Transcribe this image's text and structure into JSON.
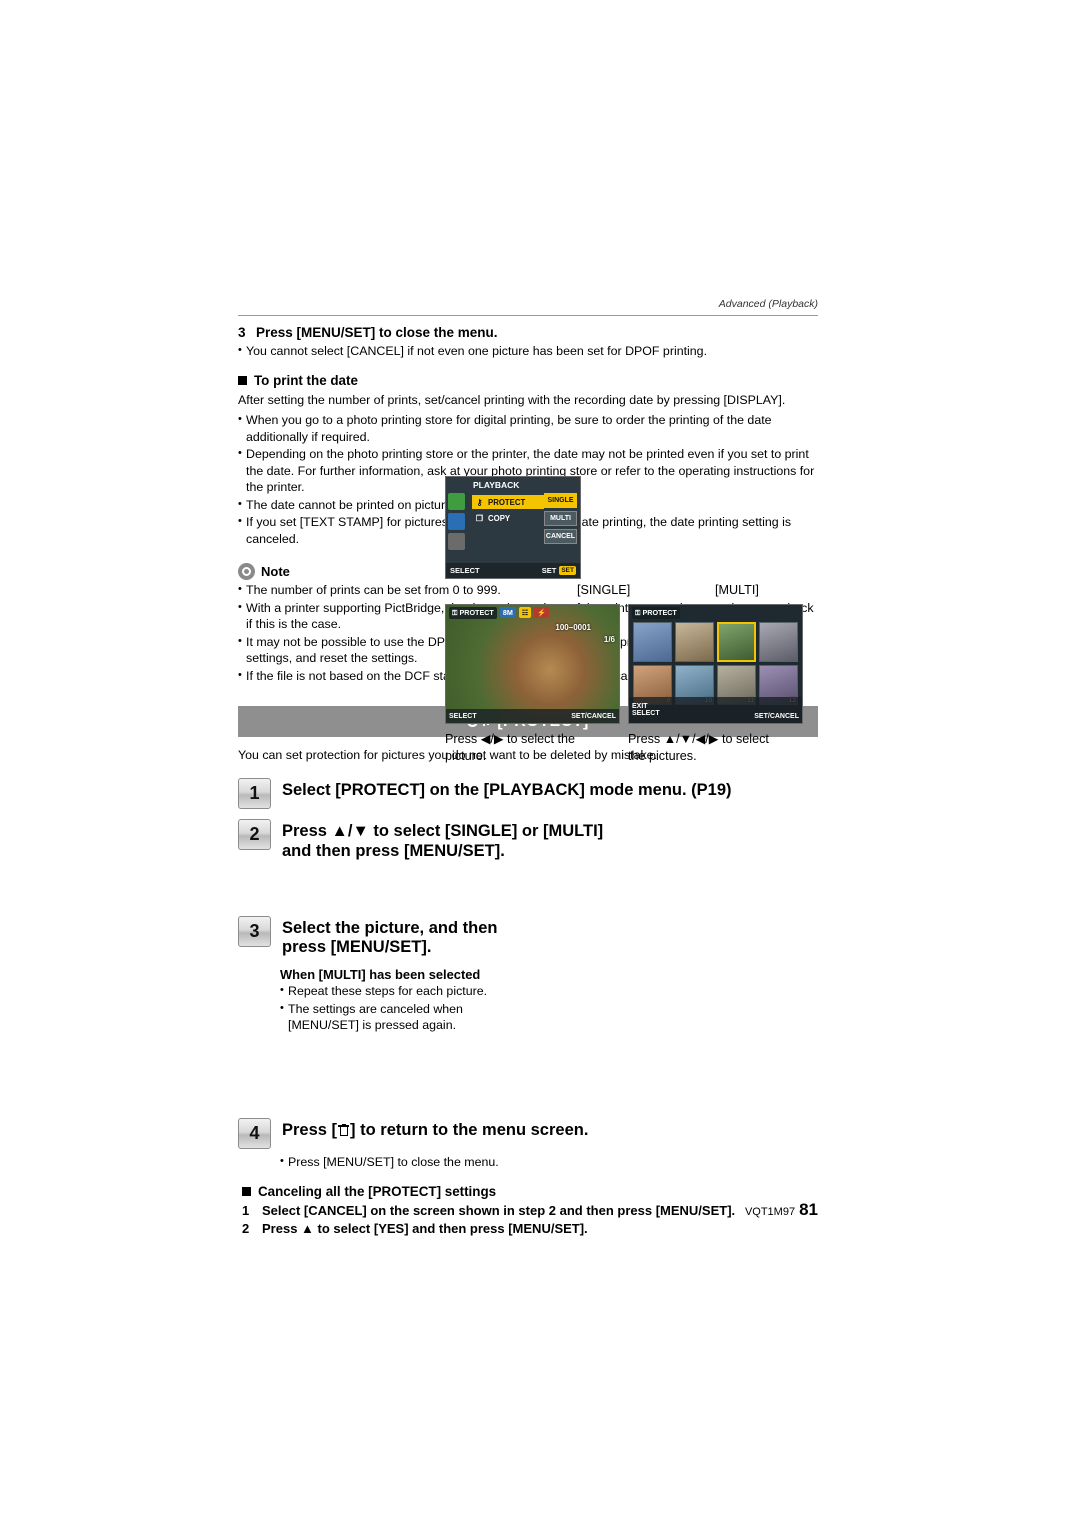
{
  "header": {
    "section_label": "Advanced (Playback)"
  },
  "step3_top": {
    "number": "3",
    "title": "Press [MENU/SET] to close the menu.",
    "bullet": "You cannot select [CANCEL] if not even one picture has been set for DPOF printing."
  },
  "print_date": {
    "heading": "To print the date",
    "intro": "After setting the number of prints, set/cancel printing with the recording date by pressing [DISPLAY].",
    "bullets": [
      "When you go to a photo printing store for digital printing, be sure to order the printing of the date additionally if required.",
      "Depending on the photo printing store or the printer, the date may not be printed even if you set to print the date. For further information, ask at your photo printing store or refer to the operating instructions for the printer.",
      "The date cannot be printed on pictures stamped with text.",
      "If you set [TEXT STAMP] for pictures that have been set for date printing, the date printing setting is canceled."
    ]
  },
  "note": {
    "title": "Note",
    "bullets": [
      "The number of prints can be set from 0 to 999.",
      "With a printer supporting PictBridge, the date print settings of the printer may take precedence so check if this is the case.",
      "It may not be possible to use the DPOF print settings with other equipment. In this case, cancel all the settings, and reset the settings.",
      "If the file is not based on the DCF standard, the DPOF print setting cannot be set."
    ]
  },
  "protect_section": {
    "bar_title": "[PROTECT]",
    "intro": "You can set protection for pictures you do not want to be deleted by mistake.",
    "steps": [
      {
        "number": "1",
        "title": "Select [PROTECT] on the [PLAYBACK] mode menu. (P19)"
      },
      {
        "number": "2",
        "title": "Press ▲/▼ to select [SINGLE] or [MULTI] and then press [MENU/SET]."
      },
      {
        "number": "3",
        "title": "Select the picture, and then press [MENU/SET]."
      },
      {
        "number": "4",
        "title": "Press [  ] to return to the menu screen."
      }
    ],
    "step3_sub_heading": "When [MULTI] has been selected",
    "step3_sub_bullets": [
      "Repeat these steps for each picture.",
      "The settings are canceled when [MENU/SET] is pressed again."
    ],
    "step4_bullet": "Press [MENU/SET] to close the menu.",
    "cancel_heading": "Canceling all the [PROTECT] settings",
    "cancel_steps": [
      {
        "number": "1",
        "text": "Select [CANCEL] on the screen shown in step 2 and then press [MENU/SET]."
      },
      {
        "number": "2",
        "text": "Press ▲ to select [YES] and then press [MENU/SET]."
      }
    ]
  },
  "menu_screen": {
    "title": "PLAYBACK",
    "items": [
      {
        "icon": "⚷",
        "label": "PROTECT",
        "selected": true
      },
      {
        "icon": "❐",
        "label": "COPY",
        "selected": false
      }
    ],
    "options": [
      {
        "label": "SINGLE",
        "selected": true
      },
      {
        "label": "MULTI",
        "selected": false
      },
      {
        "label": "CANCEL",
        "selected": false
      }
    ],
    "footer_left": "SELECT",
    "footer_right": "SET"
  },
  "single_screen": {
    "label": "[SINGLE]",
    "top_left": "PROTECT",
    "chips": [
      "8M",
      "☷",
      "⚡"
    ],
    "file_no": "100–0001",
    "counter": "1/6",
    "footer_left": "SELECT",
    "footer_right": "SET/CANCEL",
    "caption": "Press ◀/▶ to select the picture."
  },
  "multi_screen": {
    "label": "[MULTI]",
    "top_left": "PROTECT",
    "footer_left": "EXIT",
    "footer_left2": "SELECT",
    "footer_right": "SET/CANCEL",
    "thumb_numbers": [
      "9",
      "10",
      "11",
      "12"
    ],
    "caption": "Press ▲/▼/◀/▶ to select the pictures."
  },
  "footer": {
    "doc_code": "VQT1M97",
    "page_number": "81"
  }
}
